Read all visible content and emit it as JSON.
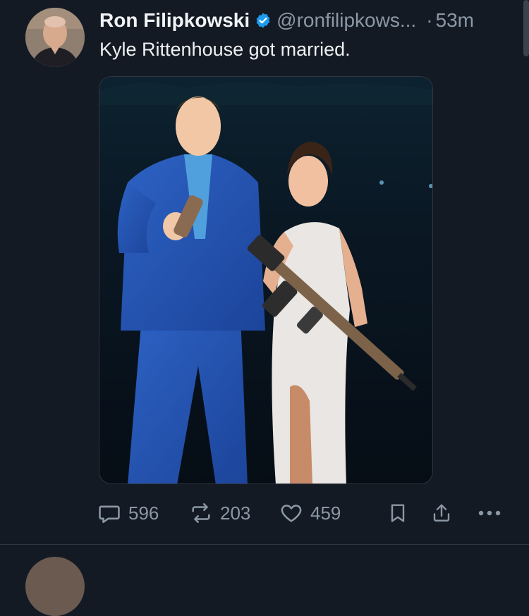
{
  "post": {
    "author_name": "Ron Filipkowski",
    "handle": "@ronfilipkows...",
    "separator": "·",
    "time": "53m",
    "text": "Kyle Rittenhouse got married.",
    "avatar_icon": "profile-photo",
    "verified_icon": "verified-check-icon",
    "media": {
      "type": "photo",
      "description_icon": "photo"
    }
  },
  "actions": {
    "replies": "596",
    "reposts": "203",
    "likes": "459",
    "reply_icon": "comment-bubble-icon",
    "repost_icon": "repost-arrows-icon",
    "like_icon": "heart-icon",
    "bookmark_icon": "bookmark-icon",
    "share_icon": "share-upload-icon",
    "more_icon": "more-dots-icon"
  },
  "colors": {
    "background": "#141a24",
    "text": "#e7e9ea",
    "muted": "#8b98a5",
    "verified": "#1d9bf0"
  }
}
